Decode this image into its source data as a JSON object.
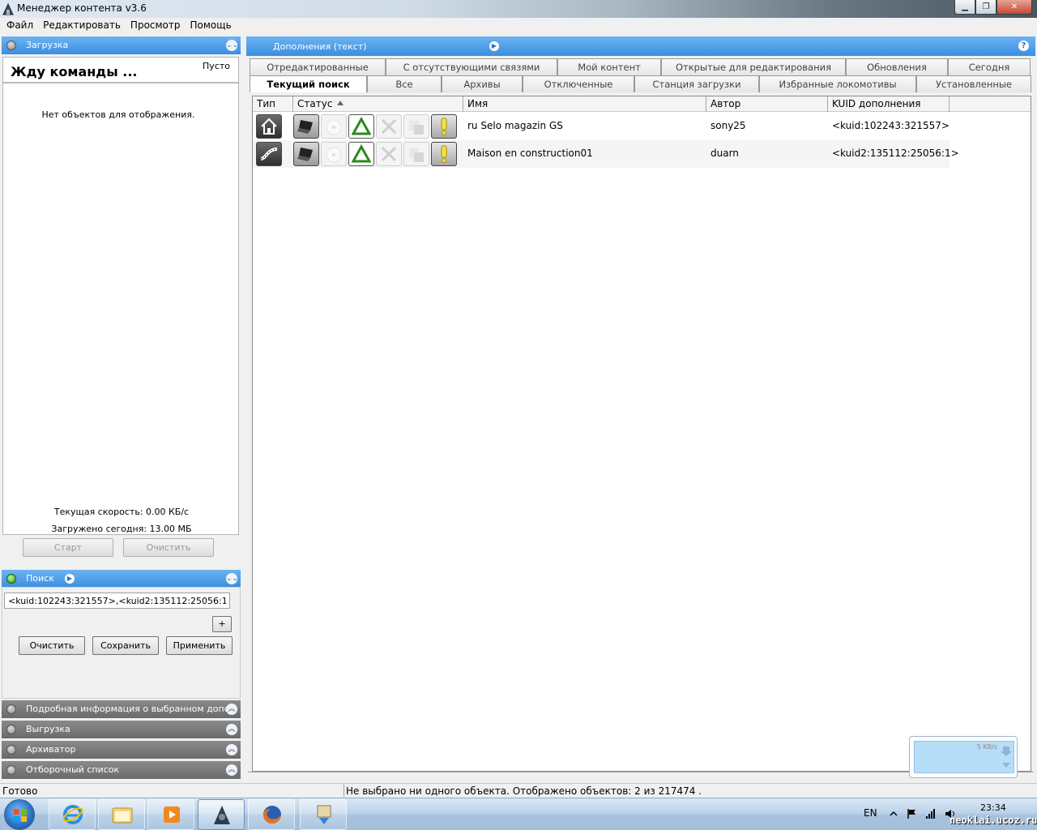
{
  "window": {
    "title": "Менеджер контента v3.6"
  },
  "menu": [
    "Файл",
    "Редактировать",
    "Просмотр",
    "Помощь"
  ],
  "download": {
    "header": "Загрузка",
    "status": "Жду команды ...",
    "empty_label": "Пусто",
    "no_objects": "Нет объектов для отображения.",
    "speed": "Текущая скорость:  0.00 КБ/с",
    "loaded_today": "Загружено сегодня:  13.00 МБ",
    "start_label": "Старт",
    "clear_label": "Очистить"
  },
  "search": {
    "header": "Поиск",
    "query": "<kuid:102243:321557>,<kuid2:135112:25056:1>",
    "add_label": "+",
    "clear_label": "Очистить",
    "save_label": "Сохранить",
    "apply_label": "Применить"
  },
  "collapsed_sections": [
    "Подробная информация о выбранном дополнении",
    "Выгрузка",
    "Архиватор",
    "Отборочный список"
  ],
  "content": {
    "header": "Дополнения (текст)",
    "help": "?",
    "tabs_row1": [
      "Отредактированные",
      "С отсутствующими связями",
      "Мой контент",
      "Открытые для редактирования",
      "Обновления",
      "Сегодня"
    ],
    "tabs_row2": [
      "Текущий поиск",
      "Все",
      "Архивы",
      "Отключенные",
      "Станция загрузки",
      "Избранные локомотивы",
      "Установленные"
    ],
    "active_tab": "Текущий поиск",
    "columns": [
      "Тип",
      "Статус",
      "Имя",
      "Автор",
      "KUID дополнения"
    ],
    "rows": [
      {
        "type_icon": "house-icon",
        "name": "ru Selo magazin GS",
        "author": "sony25",
        "kuid": "<kuid:102243:321557>"
      },
      {
        "type_icon": "road-icon",
        "name": "Maison en construction01",
        "author": "duarn",
        "kuid": "<kuid2:135112:25056:1>"
      }
    ],
    "status_icons": [
      "laptop-icon",
      "disc-icon",
      "triangle-icon",
      "tools-icon",
      "squares-icon",
      "warning-icon"
    ]
  },
  "notify": {
    "rate": "5 KB/s"
  },
  "statusbar": {
    "left": "Готово",
    "right": "Не выбрано ни одного объекта. Отображено объектов: 2 из 217474 ."
  },
  "taskbar": {
    "lang": "EN",
    "time": "23:34",
    "watermark": "neoklai.ucoz.ru"
  },
  "colors": {
    "accent_blue": "#3a8ee0",
    "section_gray": "#6b6b6b"
  }
}
